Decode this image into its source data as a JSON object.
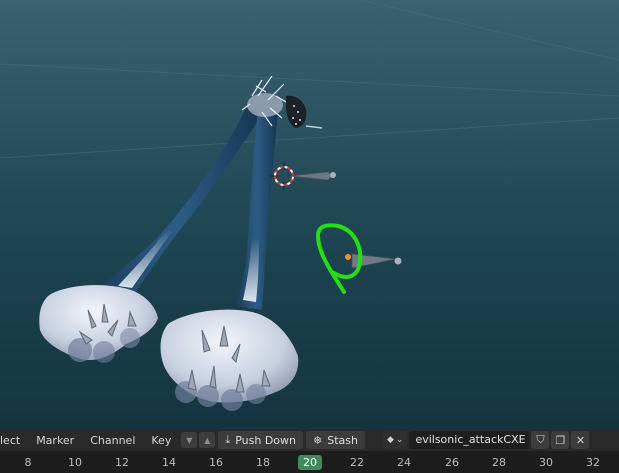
{
  "viewport": {
    "annotation_color": "#22e013",
    "sky_colors": [
      "#3a6270",
      "#143440"
    ]
  },
  "header": {
    "menus": [
      "lect",
      "Marker",
      "Channel",
      "Key"
    ],
    "push_down_label": "Push Down",
    "stash_label": "Stash",
    "action_name": "evilsonic_attackCXE"
  },
  "timeline": {
    "frames": [
      "8",
      "10",
      "12",
      "14",
      "16",
      "18",
      "20",
      "22",
      "24",
      "26",
      "28",
      "30",
      "32"
    ],
    "current_frame": "20",
    "current_color": "#3d8c5a"
  }
}
